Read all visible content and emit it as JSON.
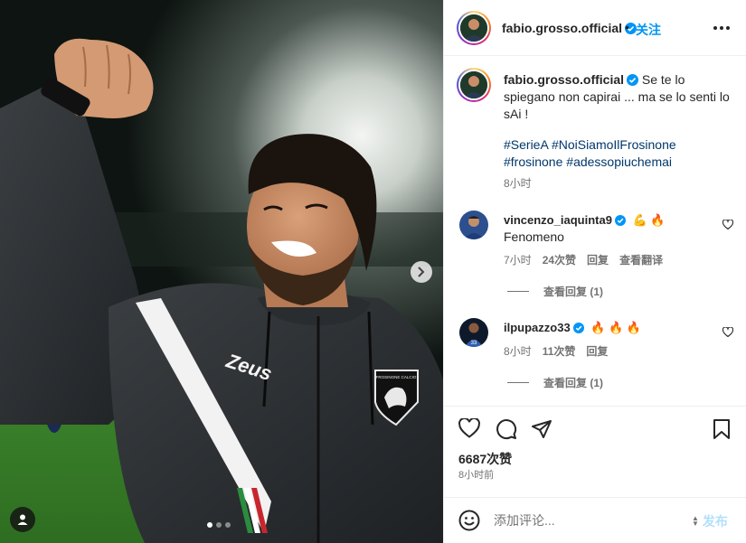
{
  "post": {
    "username": "fabio.grosso.official",
    "follow_label": "关注",
    "separator": "•",
    "caption_user": "fabio.grosso.official",
    "caption_text": "Se te lo spiegano non capirai ... ma se lo senti lo sAi !",
    "hashtags": [
      "#SerieA",
      "#NoiSiamoIlFrosinone",
      "#frosinone",
      "#adessopiuchemai"
    ],
    "caption_time": "8小时",
    "photo": {
      "jersey_brand": "Zeus",
      "crest_text": "FROSINONE CALCIO",
      "carousel_count": 3,
      "carousel_active": 1
    }
  },
  "comments": [
    {
      "user": "vincenzo_iaquinta9",
      "emojis": "💪 🔥",
      "text": "Fenomeno",
      "time": "7小时",
      "likes": "24次赞",
      "reply_label": "回复",
      "translate_label": "查看翻译",
      "view_replies": "查看回复 (1)"
    },
    {
      "user": "ilpupazzo33",
      "emojis": "🔥 🔥 🔥",
      "text": "",
      "time": "8小时",
      "likes": "11次赞",
      "reply_label": "回复",
      "view_replies": "查看回复 (1)"
    }
  ],
  "footer": {
    "likes_count": "6687次赞",
    "post_time": "8小时前",
    "comment_placeholder": "添加评论...",
    "post_label": "发布"
  },
  "colors": {
    "accent": "#0095f6",
    "hashtag": "#00376b",
    "verified": "#0095f6",
    "muted": "#737373"
  },
  "icons": [
    "verified-badge-icon",
    "more-options-icon",
    "heart-icon",
    "comment-icon",
    "share-icon",
    "bookmark-icon",
    "emoji-icon",
    "next-image-icon",
    "tag-user-icon"
  ]
}
